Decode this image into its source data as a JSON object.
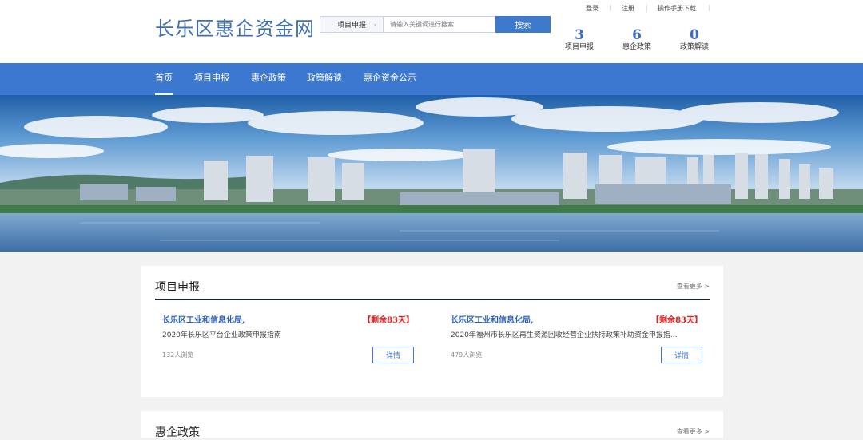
{
  "header": {
    "site_title": "长乐区惠企资金网",
    "search": {
      "category": "项目申报",
      "placeholder": "请输入关键词进行搜索",
      "button_label": "搜索"
    },
    "top_links": [
      "登录",
      "注册",
      "操作手册下载"
    ],
    "stats": [
      {
        "value": "3",
        "label": "项目申报"
      },
      {
        "value": "6",
        "label": "惠企政策"
      },
      {
        "value": "0",
        "label": "政策解读"
      }
    ]
  },
  "nav": {
    "items": [
      "首页",
      "项目申报",
      "惠企政策",
      "政策解读",
      "惠企资金公示"
    ],
    "active": "首页"
  },
  "sections": [
    {
      "title": "项目申报",
      "more": "查看更多 >",
      "items": [
        {
          "org": "长乐区工业和信息化局,",
          "remaining": "【剩余83天】",
          "desc": "2020年长乐区平台企业政策申报指南",
          "views": "132人浏览",
          "button": "详情"
        },
        {
          "org": "长乐区工业和信息化局,",
          "remaining": "【剩余83天】",
          "desc": "2020年福州市长乐区再生资源回收经营企业扶持政策补助资金申报指...",
          "views": "479人浏览",
          "button": "详情"
        }
      ]
    },
    {
      "title": "惠企政策",
      "more": "查看更多 >"
    }
  ],
  "colors": {
    "brand_blue": "#3c78cf",
    "title_blue": "#3f6fb0",
    "alert_red": "#e02020"
  }
}
